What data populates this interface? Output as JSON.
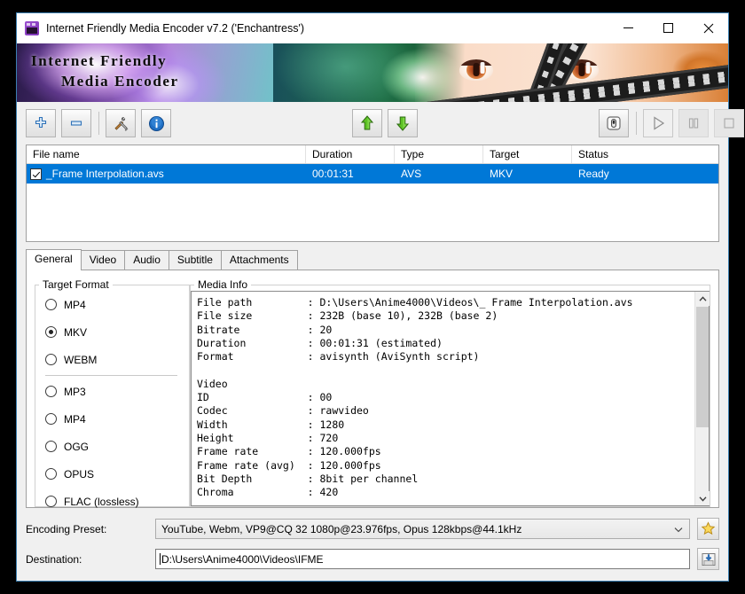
{
  "window": {
    "title": "Internet Friendly Media Encoder v7.2 ('Enchantress')",
    "app_icon": "clapperboard-icon",
    "controls": {
      "minimize": "minimize-icon",
      "maximize": "maximize-icon",
      "close": "close-icon"
    }
  },
  "banner": {
    "line1": "Internet Friendly",
    "line2": "Media Encoder"
  },
  "toolbar": {
    "add": "plus-icon",
    "remove": "minus-icon",
    "tools": "tools-icon",
    "info": "info-icon",
    "move_up": "green-up-arrow-icon",
    "move_down": "green-down-arrow-icon",
    "eject": "eject-icon",
    "play": "play-icon",
    "pause": "pause-icon",
    "stop": "stop-icon"
  },
  "filelist": {
    "columns": [
      "File name",
      "Duration",
      "Type",
      "Target",
      "Status"
    ],
    "rows": [
      {
        "checked": true,
        "name": "_Frame Interpolation.avs",
        "duration": "00:01:31",
        "type": "AVS",
        "target": "MKV",
        "status": "Ready"
      }
    ]
  },
  "tabs": [
    {
      "label": "General",
      "active": true
    },
    {
      "label": "Video",
      "active": false
    },
    {
      "label": "Audio",
      "active": false
    },
    {
      "label": "Subtitle",
      "active": false
    },
    {
      "label": "Attachments",
      "active": false
    }
  ],
  "target_format": {
    "legend": "Target Format",
    "options": [
      {
        "label": "MP4",
        "selected": false
      },
      {
        "label": "MKV",
        "selected": true
      },
      {
        "label": "WEBM",
        "selected": false
      },
      {
        "label": "MP3",
        "selected": false
      },
      {
        "label": "MP4",
        "selected": false
      },
      {
        "label": "OGG",
        "selected": false
      },
      {
        "label": "OPUS",
        "selected": false
      },
      {
        "label": "FLAC (lossless)",
        "selected": false
      }
    ],
    "divider_after_index": 2
  },
  "media_info": {
    "legend": "Media Info",
    "text": "File path         : D:\\Users\\Anime4000\\Videos\\_ Frame Interpolation.avs\nFile size         : 232B (base 10), 232B (base 2)\nBitrate           : 20\nDuration          : 00:01:31 (estimated)\nFormat            : avisynth (AviSynth script)\n\nVideo\nID                : 00\nCodec             : rawvideo\nWidth             : 1280\nHeight            : 720\nFrame rate        : 120.000fps\nFrame rate (avg)  : 120.000fps\nBit Depth         : 8bit per channel\nChroma            : 420",
    "scroll_up": "chevron-up-icon",
    "scroll_down": "chevron-down-icon"
  },
  "bottom": {
    "preset_label": "Encoding Preset:",
    "preset_value": "YouTube, Webm, VP9@CQ 32 1080p@23.976fps, Opus 128kbps@44.1kHz",
    "preset_dropdown_icon": "chevron-down-icon",
    "preset_favorite_icon": "star-icon",
    "destination_label": "Destination:",
    "destination_value": "D:\\Users\\Anime4000\\Videos\\IFME",
    "destination_browse_icon": "save-folder-icon"
  },
  "colors": {
    "selection_blue": "#0078d7",
    "window_border": "#3c7fb1",
    "chrome": "#f0f0f0",
    "green_arrow": "#57b828",
    "star_gold": "#f5c542"
  }
}
